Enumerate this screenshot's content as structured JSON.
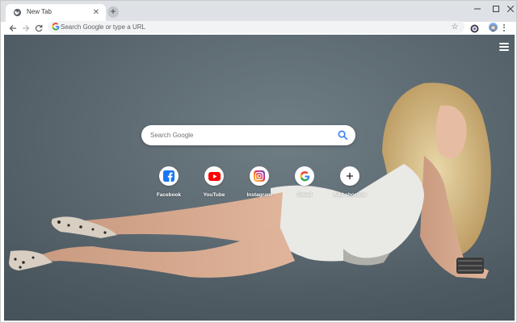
{
  "browser": {
    "tab": {
      "title": "New Tab",
      "favicon": "globe-icon"
    },
    "omnibox": {
      "placeholder": "Search Google or type a URL"
    }
  },
  "newtab": {
    "search": {
      "placeholder": "Search Google"
    },
    "shortcuts": [
      {
        "label": "Facebook",
        "icon": "facebook-icon",
        "color": "#1877f2"
      },
      {
        "label": "YouTube",
        "icon": "youtube-icon",
        "color": "#ff0000"
      },
      {
        "label": "Instagram",
        "icon": "instagram-icon",
        "color": "#c13584"
      },
      {
        "label": "Gmail",
        "icon": "google-icon",
        "color": "#4285f4"
      },
      {
        "label": "Add shortcut",
        "icon": "plus-icon",
        "color": "#202124"
      }
    ]
  },
  "colors": {
    "tabstrip": "#dee1e6",
    "omnibox": "#f1f3f4",
    "background": "#5d6a72"
  }
}
